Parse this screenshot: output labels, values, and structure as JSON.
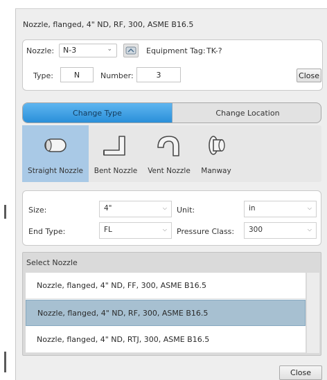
{
  "dialog": {
    "title": "Nozzle, flanged, 4\" ND, RF, 300, ASME B16.5"
  },
  "header": {
    "nozzle_label": "Nozzle:",
    "nozzle_value": "N-3",
    "equipment_tag_label": "Equipment Tag:",
    "equipment_tag_value": "TK-?",
    "type_label": "Type:",
    "type_value": "N",
    "number_label": "Number:",
    "number_value": "3",
    "close_label": "Close"
  },
  "segment": {
    "change_type": "Change Type",
    "change_location": "Change Location"
  },
  "types": [
    {
      "label": "Straight Nozzle",
      "icon": "straight-nozzle-icon"
    },
    {
      "label": "Bent Nozzle",
      "icon": "bent-nozzle-icon"
    },
    {
      "label": "Vent Nozzle",
      "icon": "vent-nozzle-icon"
    },
    {
      "label": "Manway",
      "icon": "manway-icon"
    }
  ],
  "props": {
    "size_label": "Size:",
    "size_value": "4\"",
    "unit_label": "Unit:",
    "unit_value": "in",
    "end_type_label": "End Type:",
    "end_type_value": "FL",
    "pressure_class_label": "Pressure Class:",
    "pressure_class_value": "300"
  },
  "select": {
    "header": "Select Nozzle",
    "items": [
      "Nozzle, flanged, 4\" ND, FF, 300, ASME B16.5",
      "Nozzle, flanged, 4\" ND, RF, 300, ASME B16.5",
      "Nozzle, flanged, 4\" ND, RTJ, 300, ASME B16.5"
    ]
  },
  "footer": {
    "close_label": "Close"
  },
  "colors": {
    "accent": "#2a8fd9",
    "selection": "#a7c0d1"
  }
}
